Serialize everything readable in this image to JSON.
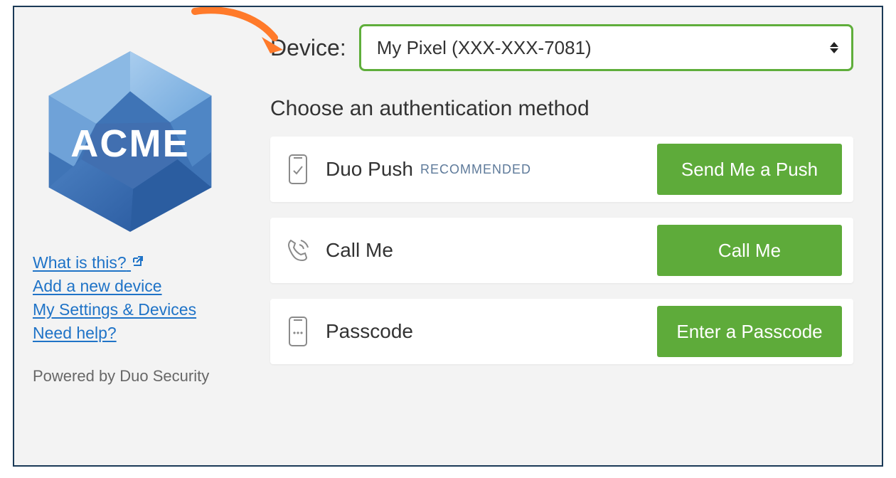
{
  "brand": {
    "logo_text": "ACME"
  },
  "sidebar": {
    "links": {
      "what_is_this": "What is this?",
      "add_device": "Add a new device",
      "settings_devices": "My Settings & Devices",
      "need_help": "Need help?"
    },
    "powered_by": "Powered by Duo Security"
  },
  "main": {
    "device_label": "Device:",
    "device_selected": "My Pixel (XXX-XXX-7081)",
    "section_title": "Choose an authentication method",
    "methods": {
      "push": {
        "label": "Duo Push",
        "tag": "RECOMMENDED",
        "button": "Send Me a Push"
      },
      "call": {
        "label": "Call Me",
        "button": "Call Me"
      },
      "passcode": {
        "label": "Passcode",
        "button": "Enter a Passcode"
      }
    }
  }
}
